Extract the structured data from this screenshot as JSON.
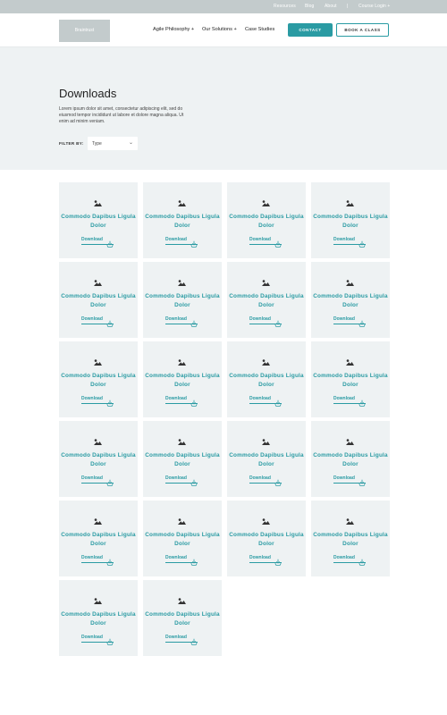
{
  "utility": {
    "links": [
      "Resources",
      "Blog",
      "About"
    ],
    "separator": "|",
    "login": "Course Login +"
  },
  "header": {
    "logo": "Braintrust",
    "nav": [
      "Agile Philosophy +",
      "Our Solutions +",
      "Case Studies"
    ],
    "contact": "CONTACT",
    "book": "BOOK A CLASS"
  },
  "hero": {
    "title": "Downloads",
    "description": "Lorem ipsum dolor sit amet, consectetur adipiscing elit, sed do eiusmod tempor incididunt ut labore et dolore magna aliqua. Ut enim ad minim veniam.",
    "filter_label": "FILTER BY:",
    "filter_value": "Type"
  },
  "colors": {
    "accent": "#2a9ba3",
    "card_bg": "#eef2f3",
    "utility_bg": "#c3cbcc"
  },
  "cards": [
    {
      "title": "Commodo Dapibus Ligula Dolor",
      "link": "Download",
      "icon": "image-icon"
    },
    {
      "title": "Commodo Dapibus Ligula Dolor",
      "link": "Download",
      "icon": "image-icon"
    },
    {
      "title": "Commodo Dapibus Ligula Dolor",
      "link": "Download",
      "icon": "image-icon"
    },
    {
      "title": "Commodo Dapibus Ligula Dolor",
      "link": "Download",
      "icon": "image-icon"
    },
    {
      "title": "Commodo Dapibus Ligula Dolor",
      "link": "Download",
      "icon": "image-icon"
    },
    {
      "title": "Commodo Dapibus Ligula Dolor",
      "link": "Download",
      "icon": "image-icon"
    },
    {
      "title": "Commodo Dapibus Ligula Dolor",
      "link": "Download",
      "icon": "image-icon"
    },
    {
      "title": "Commodo Dapibus Ligula Dolor",
      "link": "Download",
      "icon": "image-icon"
    },
    {
      "title": "Commodo Dapibus Ligula Dolor",
      "link": "Download",
      "icon": "image-icon"
    },
    {
      "title": "Commodo Dapibus Ligula Dolor",
      "link": "Download",
      "icon": "image-icon"
    },
    {
      "title": "Commodo Dapibus Ligula Dolor",
      "link": "Download",
      "icon": "image-icon"
    },
    {
      "title": "Commodo Dapibus Ligula Dolor",
      "link": "Download",
      "icon": "image-icon"
    },
    {
      "title": "Commodo Dapibus Ligula Dolor",
      "link": "Download",
      "icon": "image-icon"
    },
    {
      "title": "Commodo Dapibus Ligula Dolor",
      "link": "Download",
      "icon": "image-icon"
    },
    {
      "title": "Commodo Dapibus Ligula Dolor",
      "link": "Download",
      "icon": "image-icon"
    },
    {
      "title": "Commodo Dapibus Ligula Dolor",
      "link": "Download",
      "icon": "image-icon"
    },
    {
      "title": "Commodo Dapibus Ligula Dolor",
      "link": "Download",
      "icon": "image-icon"
    },
    {
      "title": "Commodo Dapibus Ligula Dolor",
      "link": "Download",
      "icon": "image-icon"
    },
    {
      "title": "Commodo Dapibus Ligula Dolor",
      "link": "Download",
      "icon": "image-icon"
    },
    {
      "title": "Commodo Dapibus Ligula Dolor",
      "link": "Download",
      "icon": "image-icon"
    },
    {
      "title": "Commodo Dapibus Ligula Dolor",
      "link": "Download",
      "icon": "image-icon"
    },
    {
      "title": "Commodo Dapibus Ligula Dolor",
      "link": "Download",
      "icon": "image-icon"
    }
  ]
}
